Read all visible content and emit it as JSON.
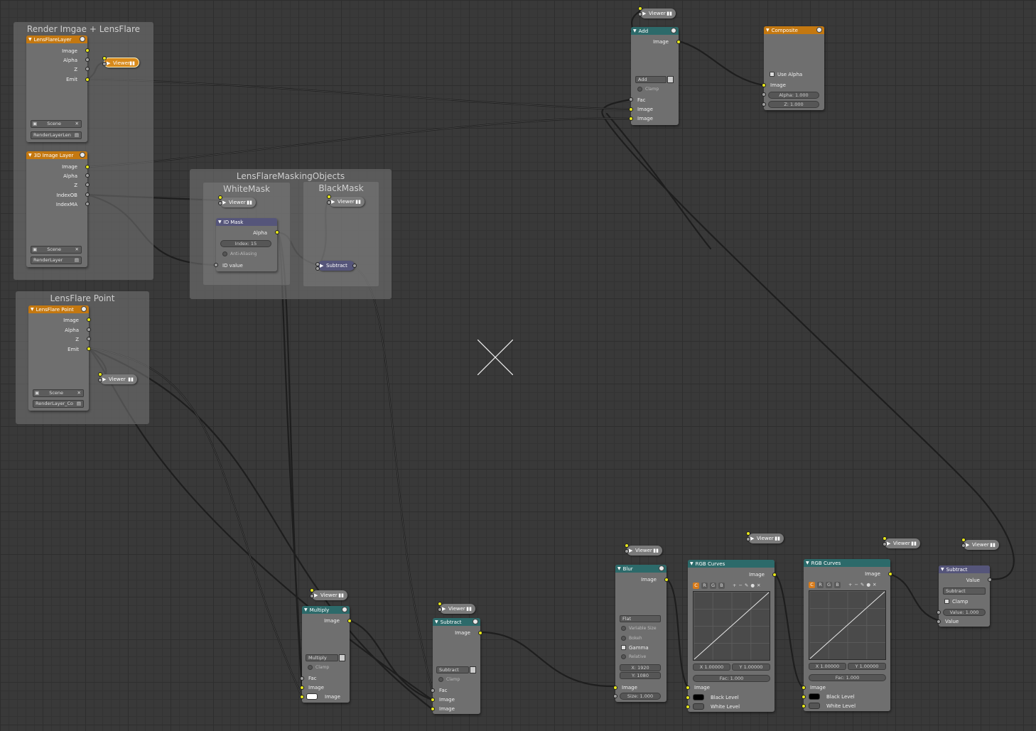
{
  "frames": {
    "render": {
      "title": "Render Imgae + LensFlare"
    },
    "masking": {
      "title": "LensFlareMaskingObjects"
    },
    "white": {
      "title": "WhiteMask"
    },
    "black": {
      "title": "BlackMask"
    },
    "point": {
      "title": "LensFlare Point"
    }
  },
  "nodes": {
    "lensflare_layer": {
      "title": "LensFlareLayer",
      "outputs": [
        "Image",
        "Alpha",
        "Z",
        "Emit"
      ],
      "scene": "Scene",
      "layer": "RenderLayerLen"
    },
    "image_layer": {
      "title": "3D Image Layer",
      "outputs": [
        "Image",
        "Alpha",
        "Z",
        "IndexOB",
        "IndexMA"
      ],
      "scene": "Scene",
      "layer": "RenderLayer"
    },
    "lensflare_point": {
      "title": "LensFlare Point",
      "outputs": [
        "Image",
        "Alpha",
        "Z",
        "Emit"
      ],
      "scene": "Scene",
      "layer": "RenderLayer_Co"
    },
    "id_mask": {
      "title": "ID Mask",
      "output": "Alpha",
      "index": "Index: 15",
      "anti": "Anti-Aliasing",
      "input": "ID value"
    },
    "bm_subtract": {
      "title": "Subtract"
    },
    "add": {
      "title": "Add",
      "output": "Image",
      "mode": "Add",
      "clamp": "Clamp",
      "inputs": [
        "Fac",
        "Image",
        "Image"
      ]
    },
    "composite": {
      "title": "Composite",
      "use_alpha": "Use Alpha",
      "input": "Image",
      "alpha": "Alpha: 1.000",
      "z": "Z: 1.000"
    },
    "multiply": {
      "title": "Multiply",
      "output": "Image",
      "mode": "Multiply",
      "clamp": "Clamp",
      "inputs": [
        "Fac",
        "Image",
        "Image"
      ]
    },
    "subtract_mix": {
      "title": "Subtract",
      "output": "Image",
      "mode": "Subtract",
      "clamp": "Clamp",
      "inputs": [
        "Fac",
        "Image",
        "Image"
      ]
    },
    "blur": {
      "title": "Blur",
      "output": "Image",
      "filter": "Flat",
      "variable": "Variable Size",
      "bokeh": "Bokeh",
      "gamma": "Gamma",
      "relative": "Relative",
      "x": "X: 1920",
      "y": "Y: 1080",
      "input": "Image",
      "size": "Size: 1.000"
    },
    "curves1": {
      "title": "RGB Curves",
      "output": "Image",
      "channels": [
        "C",
        "R",
        "G",
        "B"
      ],
      "x": "X 1.00000",
      "y": "Y 1.00000",
      "fac": "Fac: 1.000",
      "inputs": [
        "Image",
        "Black Level",
        "White Level"
      ]
    },
    "curves2": {
      "title": "RGB Curves",
      "output": "Image",
      "channels": [
        "C",
        "R",
        "G",
        "B"
      ],
      "x": "X 1.00000",
      "y": "Y 1.00000",
      "fac": "Fac: 1.000",
      "inputs": [
        "Image",
        "Black Level",
        "White Level"
      ]
    },
    "math_subtract": {
      "title": "Subtract",
      "output": "Value",
      "mode": "Subtract",
      "clamp": "Clamp",
      "value": "Value: 1.000",
      "input": "Value"
    }
  },
  "viewer_label": "Viewer",
  "colors": {
    "orange": "#c47810",
    "teal": "#2c6a6a",
    "purple": "#55557a",
    "socket_color": "#e8e81a",
    "socket_value": "#a0a0a0"
  }
}
